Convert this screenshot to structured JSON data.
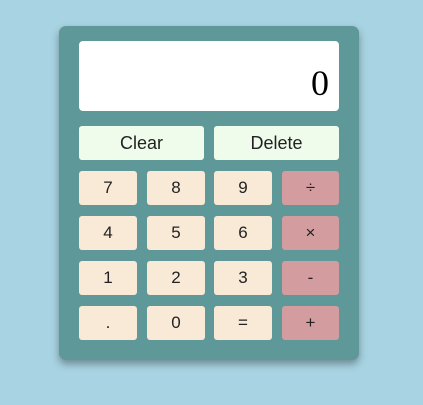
{
  "display": {
    "value": "0"
  },
  "actions": {
    "clear_label": "Clear",
    "delete_label": "Delete"
  },
  "keys": {
    "row1": [
      "7",
      "8",
      "9",
      "÷"
    ],
    "row2": [
      "4",
      "5",
      "6",
      "×"
    ],
    "row3": [
      "1",
      "2",
      "3",
      "-"
    ],
    "row4": [
      ".",
      "0",
      "=",
      "+"
    ]
  },
  "colors": {
    "background": "#a8d3e2",
    "body": "#5f9898",
    "display": "#ffffff",
    "action_button": "#effcec",
    "number_button": "#f8ead6",
    "operator_button": "#d39c9f"
  }
}
